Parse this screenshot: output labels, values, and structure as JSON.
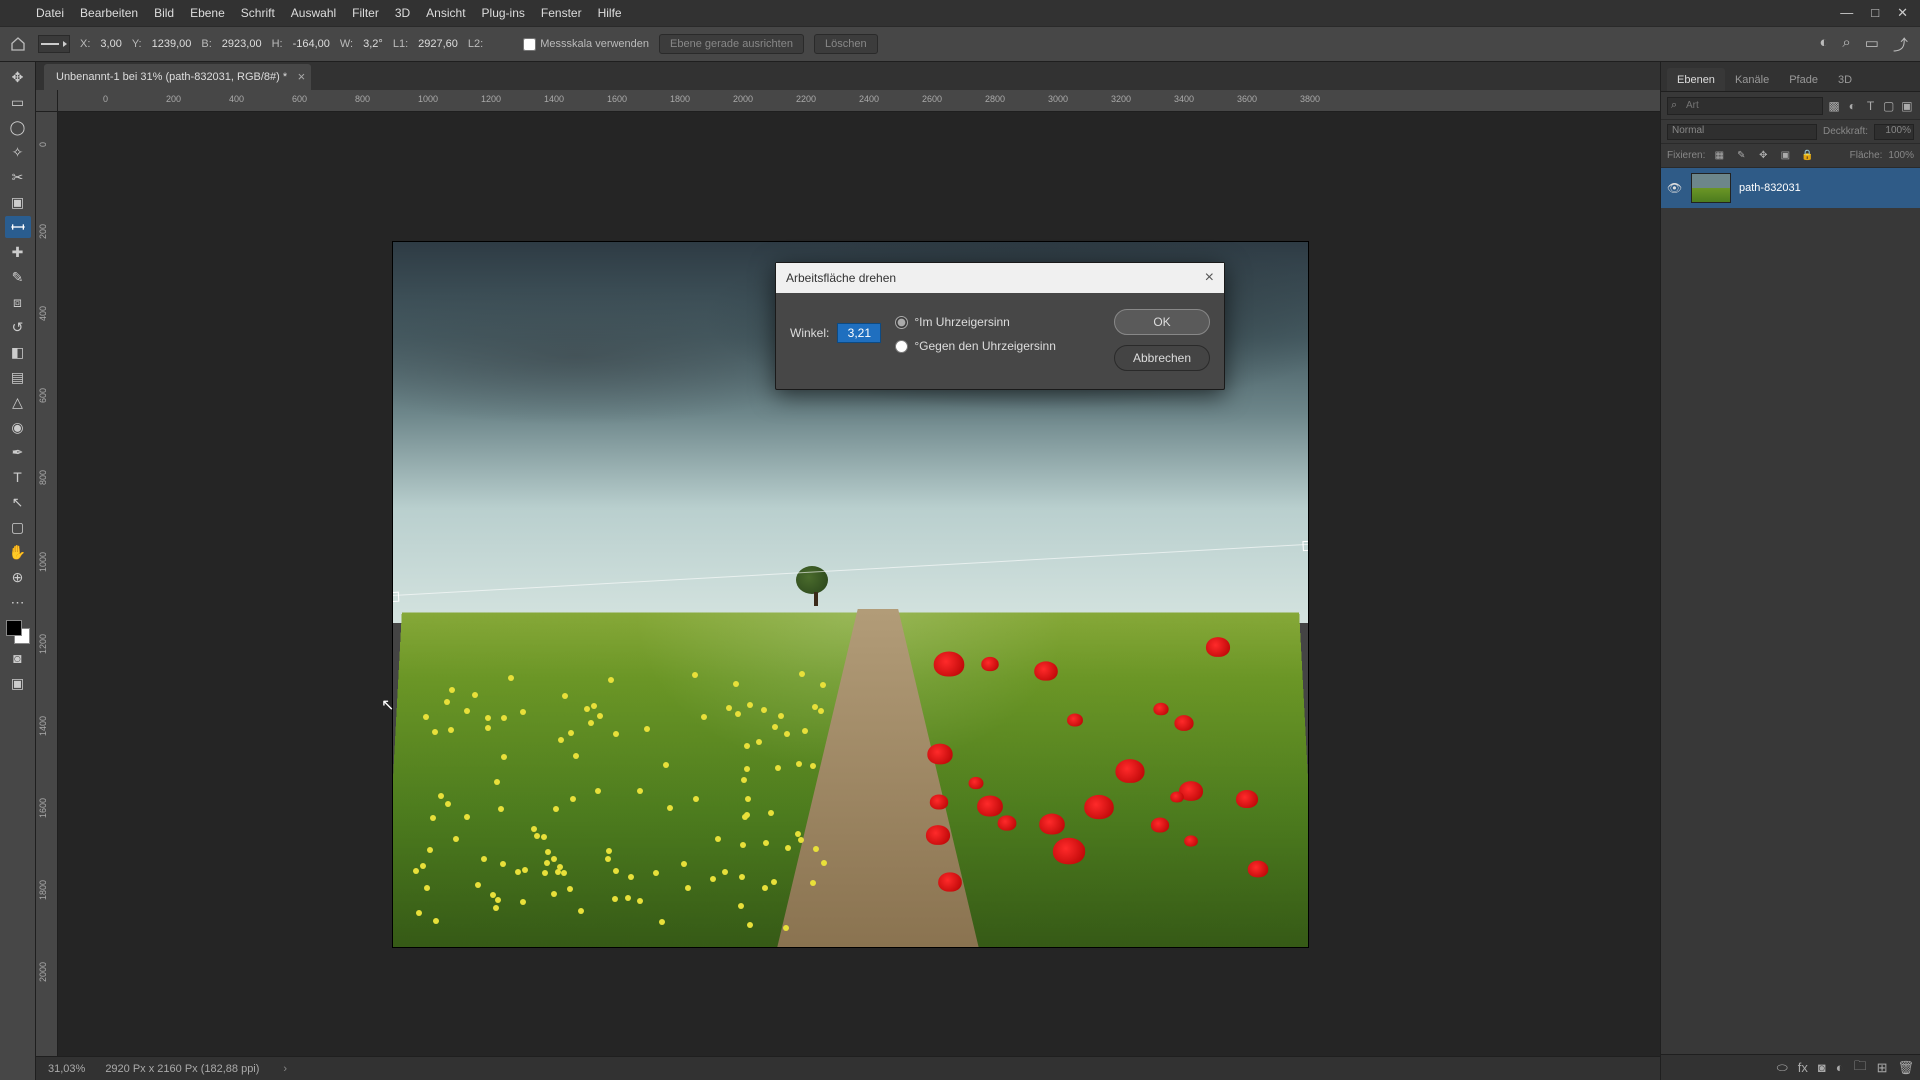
{
  "window": {
    "minimize": "—",
    "maximize": "□",
    "close": "✕"
  },
  "menu": [
    "Datei",
    "Bearbeiten",
    "Bild",
    "Ebene",
    "Schrift",
    "Auswahl",
    "Filter",
    "3D",
    "Ansicht",
    "Plug-ins",
    "Fenster",
    "Hilfe"
  ],
  "optbar": {
    "x_label": "X:",
    "x_val": "3,00",
    "y_label": "Y:",
    "y_val": "1239,00",
    "b_label": "B:",
    "b_val": "2923,00",
    "h_label": "H:",
    "h_val": "-164,00",
    "w_label": "W:",
    "w_val": "3,2°",
    "l1_label": "L1:",
    "l1_val": "2927,60",
    "l2_label": "L2:",
    "scale_chk": "Messskala verwenden",
    "straighten": "Ebene gerade ausrichten",
    "clear": "Löschen"
  },
  "doc": {
    "tab": "Unbenannt-1 bei 31% (path-832031, RGB/8#) *"
  },
  "ruler_h": [
    "0",
    "200",
    "400",
    "600",
    "800",
    "1000",
    "1200",
    "1400",
    "1600",
    "1800",
    "2000",
    "2200",
    "2400",
    "2600",
    "2800",
    "3000",
    "3200",
    "3400",
    "3600",
    "3800"
  ],
  "ruler_v": [
    "0",
    "200",
    "400",
    "600",
    "800",
    "1000",
    "1200",
    "1400",
    "1600",
    "1800",
    "2000"
  ],
  "status": {
    "zoom": "31,03%",
    "info": "2920 Px x 2160 Px (182,88 ppi)"
  },
  "panels": {
    "tabs": [
      "Ebenen",
      "Kanäle",
      "Pfade",
      "3D"
    ],
    "search_placeholder": "Art",
    "blend_mode": "Normal",
    "opacity_label": "Deckkraft:",
    "opacity_val": "100%",
    "lock_label": "Fixieren:",
    "fill_label": "Fläche:",
    "fill_val": "100%",
    "layer_name": "path-832031"
  },
  "dialog": {
    "title": "Arbeitsfläche drehen",
    "angle_label": "Winkel:",
    "angle_val": "3,21",
    "cw": "°Im Uhrzeigersinn",
    "ccw": "°Gegen den Uhrzeigersinn",
    "ok": "OK",
    "cancel": "Abbrechen"
  }
}
